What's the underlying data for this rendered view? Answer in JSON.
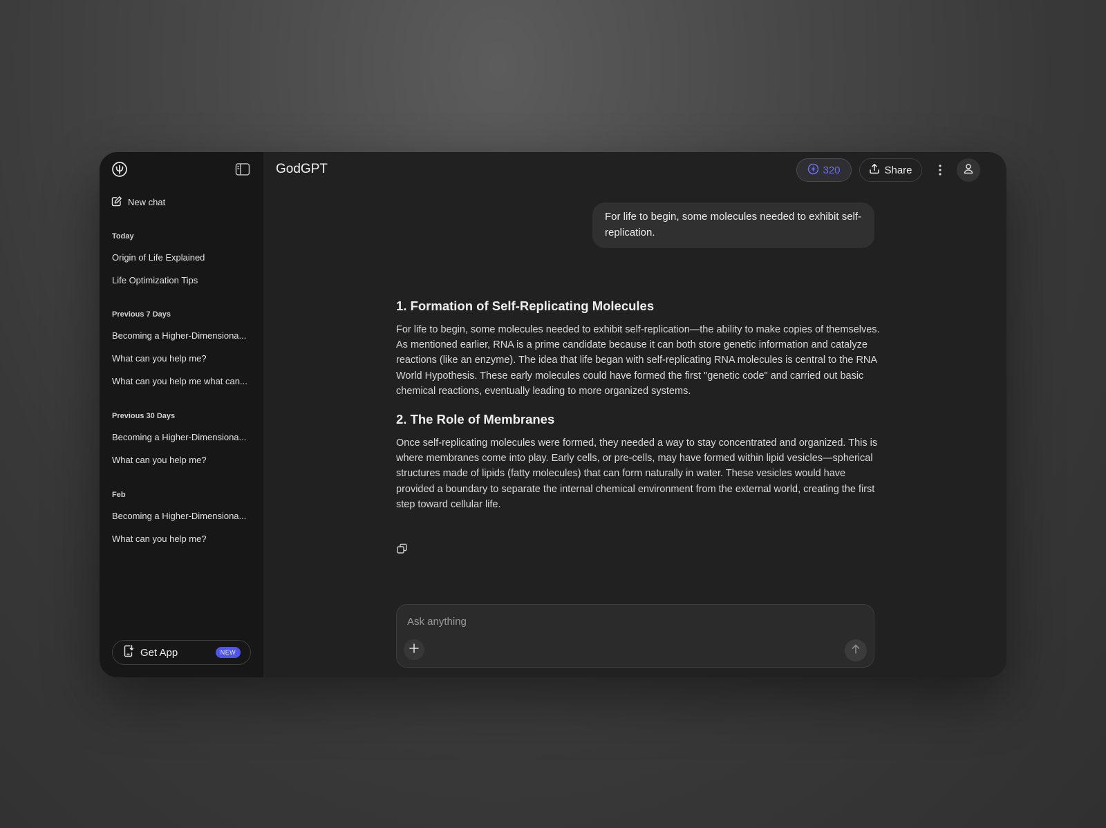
{
  "app": {
    "title": "GodGPT",
    "credits": "320",
    "share_label": "Share",
    "accent_color": "#4f55e8"
  },
  "sidebar": {
    "new_chat_label": "New chat",
    "groups": [
      {
        "title": "Today",
        "items": [
          "Origin of Life Explained",
          "Life Optimization Tips"
        ]
      },
      {
        "title": "Previous 7 Days",
        "items": [
          "Becoming a Higher-Dimensiona...",
          "What can you help me?",
          "What can you help me what can..."
        ]
      },
      {
        "title": "Previous 30 Days",
        "items": [
          "Becoming a Higher-Dimensiona...",
          "What can you help me?"
        ]
      },
      {
        "title": "Feb",
        "items": [
          "Becoming a Higher-Dimensiona...",
          "What can you help me?"
        ]
      }
    ],
    "get_app_label": "Get App",
    "new_badge": "NEW"
  },
  "chat": {
    "user_message": "For life to begin, some molecules needed to exhibit self-replication.",
    "sections": [
      {
        "heading": "1. Formation of Self-Replicating Molecules",
        "body": "For life to begin, some molecules needed to exhibit self-replication—the ability to make copies of themselves. As mentioned earlier, RNA is a prime candidate because it can both store genetic information and catalyze reactions (like an enzyme). The idea that life began with self-replicating RNA molecules is central to the RNA World Hypothesis. These early molecules could have formed the first \"genetic code\" and carried out basic chemical reactions, eventually leading to more organized systems."
      },
      {
        "heading": "2. The Role of Membranes",
        "body": "Once self-replicating molecules were formed, they needed a way to stay concentrated and organized. This is where membranes come into play. Early cells, or pre-cells, may have formed within lipid vesicles—spherical structures made of lipids (fatty molecules) that can form naturally in water. These vesicles would have provided a boundary to separate the internal chemical environment from the external world, creating the first step toward cellular life."
      }
    ]
  },
  "composer": {
    "placeholder": "Ask anything"
  },
  "icons": [
    "logo-icon",
    "sidebar-toggle-icon",
    "edit-icon",
    "phone-download-icon",
    "credits-icon",
    "upload-icon",
    "more-vertical-icon",
    "user-icon",
    "copy-icon",
    "plus-icon",
    "arrow-up-icon"
  ]
}
